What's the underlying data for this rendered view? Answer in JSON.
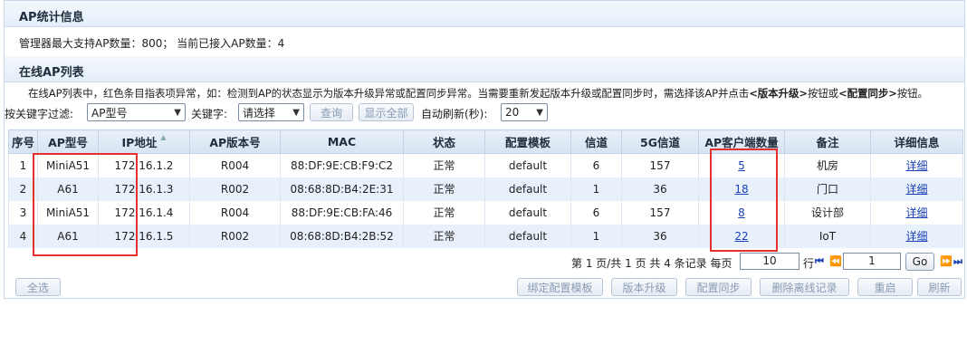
{
  "stats": {
    "title": "AP统计信息",
    "capacity_text": "管理器最大支持AP数量：800；  当前已接入AP数量：4"
  },
  "online": {
    "title": "在线AP列表",
    "notice_pre": "在线AP列表中，红色条目指表项异常，如：检测到AP的状态显示为版本升级异常或配置同步异常。当需要重新发起版本升级或配置同步时，需选择该AP并点击",
    "notice_b1": "<版本升级>",
    "notice_mid": "按钮或",
    "notice_b2": "<配置同步>",
    "notice_post": "按钮。"
  },
  "filter": {
    "key_label": "按关键字过滤:",
    "key_select": "AP型号",
    "keyword_label": "关键字:",
    "keyword_select": "请选择",
    "query_btn": "查询",
    "show_all_btn": "显示全部",
    "refresh_label": "自动刷新(秒):",
    "refresh_value": "20"
  },
  "table": {
    "headers": [
      "序号",
      "AP型号",
      "IP地址",
      "AP版本号",
      "MAC",
      "状态",
      "配置模板",
      "信道",
      "5G信道",
      "AP客户端数量",
      "备注",
      "详细信息"
    ],
    "rows": [
      {
        "idx": "1",
        "model": "MiniA51",
        "ip": "172.16.1.2",
        "ver": "R004",
        "mac": "88:DF:9E:CB:F9:C2",
        "status": "正常",
        "tpl": "default",
        "ch": "6",
        "ch5g": "157",
        "clients": "5",
        "note": "机房",
        "detail": "详细"
      },
      {
        "idx": "2",
        "model": "A61",
        "ip": "172.16.1.3",
        "ver": "R002",
        "mac": "08:68:8D:B4:2E:31",
        "status": "正常",
        "tpl": "default",
        "ch": "1",
        "ch5g": "36",
        "clients": "18",
        "note": "门口",
        "detail": "详细"
      },
      {
        "idx": "3",
        "model": "MiniA51",
        "ip": "172.16.1.4",
        "ver": "R004",
        "mac": "88:DF:9E:CB:FA:46",
        "status": "正常",
        "tpl": "default",
        "ch": "6",
        "ch5g": "157",
        "clients": "8",
        "note": "设计部",
        "detail": "详细"
      },
      {
        "idx": "4",
        "model": "A61",
        "ip": "172.16.1.5",
        "ver": "R002",
        "mac": "08:68:8D:B4:2B:52",
        "status": "正常",
        "tpl": "default",
        "ch": "1",
        "ch5g": "36",
        "clients": "22",
        "note": "IoT",
        "detail": "详细"
      }
    ]
  },
  "pager": {
    "summary": "第 1 页/共 1 页 共 4 条记录 每页",
    "per_page": "10",
    "row_label": "行",
    "page_input": "1",
    "go_label": "Go",
    "icons": {
      "first": "first-page-icon",
      "prev": "prev-page-icon",
      "next": "next-page-icon",
      "last": "last-page-icon"
    }
  },
  "actions": {
    "select_all": "全选",
    "bind_template": "绑定配置模板",
    "upgrade": "版本升级",
    "sync": "配置同步",
    "delete_offline": "删除离线记录",
    "restart": "重启",
    "refresh": "刷新"
  },
  "colors": {
    "highlight_box": "#e53030",
    "link": "#1a3fb5",
    "row_alt": "#e8f0fb"
  }
}
